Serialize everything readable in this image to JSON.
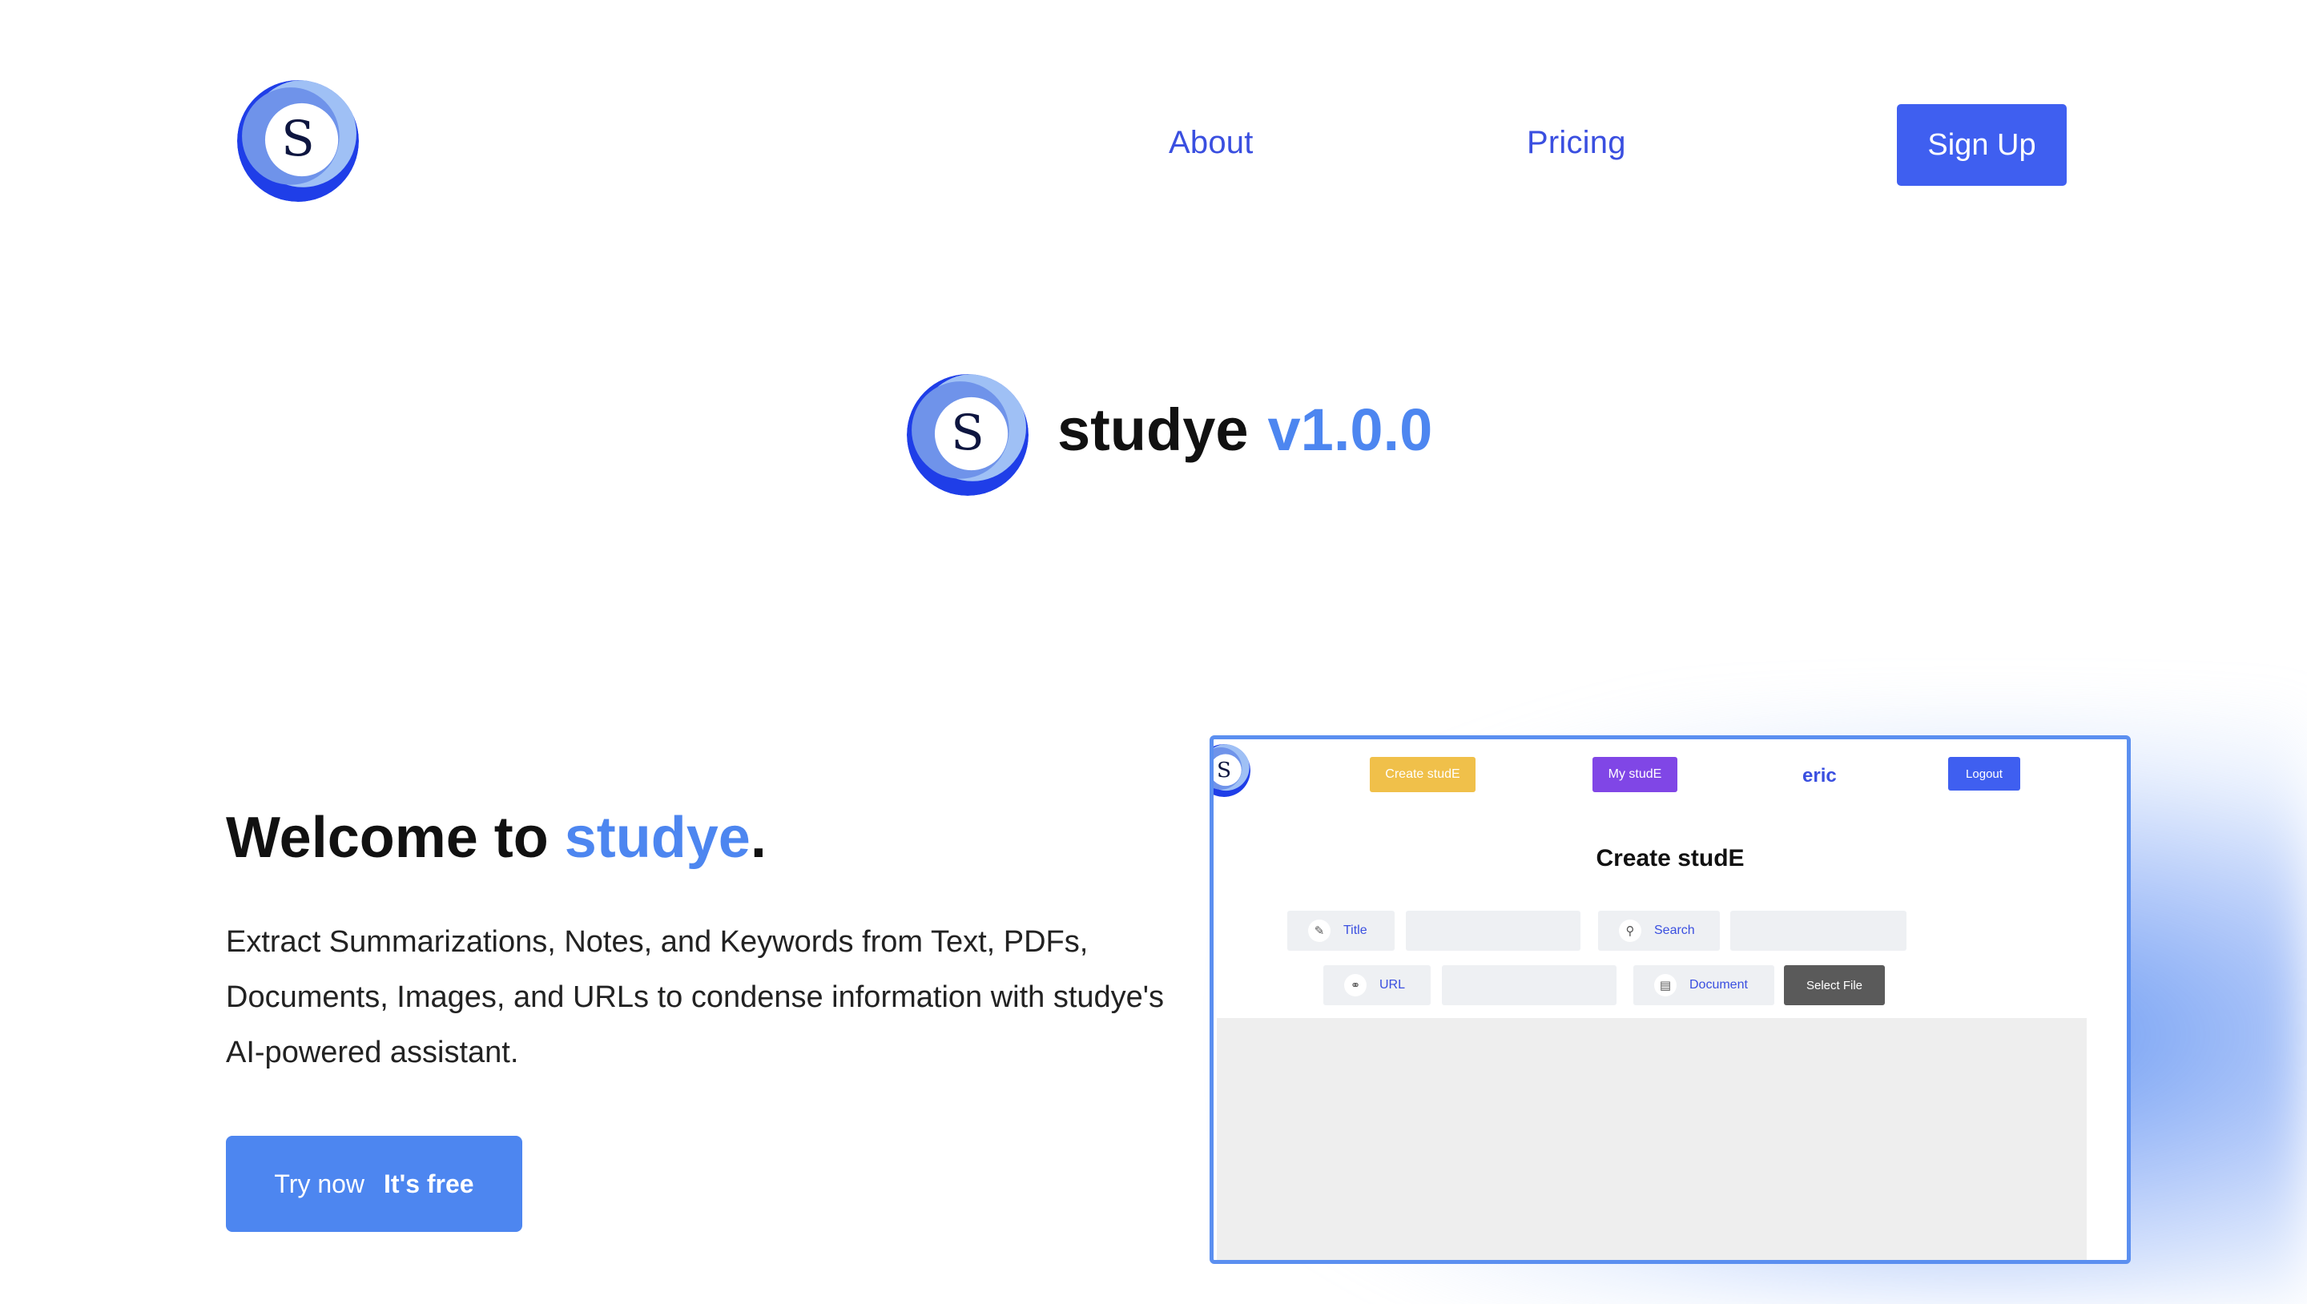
{
  "header": {
    "logo_letter": "S",
    "nav": {
      "about": "About",
      "pricing": "Pricing"
    },
    "signup_label": "Sign Up"
  },
  "brand": {
    "logo_letter": "S",
    "name": "studye",
    "version": "v1.0.0"
  },
  "hero": {
    "title_prefix": "Welcome to ",
    "title_accent": "studye",
    "title_suffix": ".",
    "description": "Extract Summarizations, Notes, and Keywords from Text, PDFs, Documents, Images, and URLs to condense information with studye's AI-powered assistant.",
    "cta_main": "Try now",
    "cta_sub": "It's free"
  },
  "preview": {
    "logo_letter": "S",
    "create_button": "Create studE",
    "my_button": "My studE",
    "username": "eric",
    "logout_button": "Logout",
    "heading": "Create studE",
    "fields": {
      "title": "Title",
      "search": "Search",
      "url": "URL",
      "document": "Document"
    },
    "select_file": "Select File"
  },
  "colors": {
    "accent": "#4d86f0",
    "nav_link": "#3a4fe0",
    "signup": "#3f5ff0",
    "create_button": "#f0c04a",
    "my_button": "#8046e6",
    "select_file": "#5a5a5a"
  }
}
